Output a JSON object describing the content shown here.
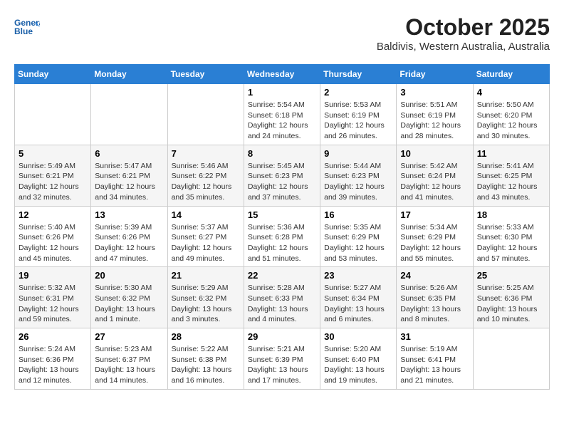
{
  "header": {
    "logo_text_1": "General",
    "logo_text_2": "Blue",
    "title": "October 2025",
    "subtitle": "Baldivis, Western Australia, Australia"
  },
  "days_of_week": [
    "Sunday",
    "Monday",
    "Tuesday",
    "Wednesday",
    "Thursday",
    "Friday",
    "Saturday"
  ],
  "weeks": [
    [
      {
        "day": "",
        "info": ""
      },
      {
        "day": "",
        "info": ""
      },
      {
        "day": "",
        "info": ""
      },
      {
        "day": "1",
        "info": "Sunrise: 5:54 AM\nSunset: 6:18 PM\nDaylight: 12 hours\nand 24 minutes."
      },
      {
        "day": "2",
        "info": "Sunrise: 5:53 AM\nSunset: 6:19 PM\nDaylight: 12 hours\nand 26 minutes."
      },
      {
        "day": "3",
        "info": "Sunrise: 5:51 AM\nSunset: 6:19 PM\nDaylight: 12 hours\nand 28 minutes."
      },
      {
        "day": "4",
        "info": "Sunrise: 5:50 AM\nSunset: 6:20 PM\nDaylight: 12 hours\nand 30 minutes."
      }
    ],
    [
      {
        "day": "5",
        "info": "Sunrise: 5:49 AM\nSunset: 6:21 PM\nDaylight: 12 hours\nand 32 minutes."
      },
      {
        "day": "6",
        "info": "Sunrise: 5:47 AM\nSunset: 6:21 PM\nDaylight: 12 hours\nand 34 minutes."
      },
      {
        "day": "7",
        "info": "Sunrise: 5:46 AM\nSunset: 6:22 PM\nDaylight: 12 hours\nand 35 minutes."
      },
      {
        "day": "8",
        "info": "Sunrise: 5:45 AM\nSunset: 6:23 PM\nDaylight: 12 hours\nand 37 minutes."
      },
      {
        "day": "9",
        "info": "Sunrise: 5:44 AM\nSunset: 6:23 PM\nDaylight: 12 hours\nand 39 minutes."
      },
      {
        "day": "10",
        "info": "Sunrise: 5:42 AM\nSunset: 6:24 PM\nDaylight: 12 hours\nand 41 minutes."
      },
      {
        "day": "11",
        "info": "Sunrise: 5:41 AM\nSunset: 6:25 PM\nDaylight: 12 hours\nand 43 minutes."
      }
    ],
    [
      {
        "day": "12",
        "info": "Sunrise: 5:40 AM\nSunset: 6:26 PM\nDaylight: 12 hours\nand 45 minutes."
      },
      {
        "day": "13",
        "info": "Sunrise: 5:39 AM\nSunset: 6:26 PM\nDaylight: 12 hours\nand 47 minutes."
      },
      {
        "day": "14",
        "info": "Sunrise: 5:37 AM\nSunset: 6:27 PM\nDaylight: 12 hours\nand 49 minutes."
      },
      {
        "day": "15",
        "info": "Sunrise: 5:36 AM\nSunset: 6:28 PM\nDaylight: 12 hours\nand 51 minutes."
      },
      {
        "day": "16",
        "info": "Sunrise: 5:35 AM\nSunset: 6:29 PM\nDaylight: 12 hours\nand 53 minutes."
      },
      {
        "day": "17",
        "info": "Sunrise: 5:34 AM\nSunset: 6:29 PM\nDaylight: 12 hours\nand 55 minutes."
      },
      {
        "day": "18",
        "info": "Sunrise: 5:33 AM\nSunset: 6:30 PM\nDaylight: 12 hours\nand 57 minutes."
      }
    ],
    [
      {
        "day": "19",
        "info": "Sunrise: 5:32 AM\nSunset: 6:31 PM\nDaylight: 12 hours\nand 59 minutes."
      },
      {
        "day": "20",
        "info": "Sunrise: 5:30 AM\nSunset: 6:32 PM\nDaylight: 13 hours\nand 1 minute."
      },
      {
        "day": "21",
        "info": "Sunrise: 5:29 AM\nSunset: 6:32 PM\nDaylight: 13 hours\nand 3 minutes."
      },
      {
        "day": "22",
        "info": "Sunrise: 5:28 AM\nSunset: 6:33 PM\nDaylight: 13 hours\nand 4 minutes."
      },
      {
        "day": "23",
        "info": "Sunrise: 5:27 AM\nSunset: 6:34 PM\nDaylight: 13 hours\nand 6 minutes."
      },
      {
        "day": "24",
        "info": "Sunrise: 5:26 AM\nSunset: 6:35 PM\nDaylight: 13 hours\nand 8 minutes."
      },
      {
        "day": "25",
        "info": "Sunrise: 5:25 AM\nSunset: 6:36 PM\nDaylight: 13 hours\nand 10 minutes."
      }
    ],
    [
      {
        "day": "26",
        "info": "Sunrise: 5:24 AM\nSunset: 6:36 PM\nDaylight: 13 hours\nand 12 minutes."
      },
      {
        "day": "27",
        "info": "Sunrise: 5:23 AM\nSunset: 6:37 PM\nDaylight: 13 hours\nand 14 minutes."
      },
      {
        "day": "28",
        "info": "Sunrise: 5:22 AM\nSunset: 6:38 PM\nDaylight: 13 hours\nand 16 minutes."
      },
      {
        "day": "29",
        "info": "Sunrise: 5:21 AM\nSunset: 6:39 PM\nDaylight: 13 hours\nand 17 minutes."
      },
      {
        "day": "30",
        "info": "Sunrise: 5:20 AM\nSunset: 6:40 PM\nDaylight: 13 hours\nand 19 minutes."
      },
      {
        "day": "31",
        "info": "Sunrise: 5:19 AM\nSunset: 6:41 PM\nDaylight: 13 hours\nand 21 minutes."
      },
      {
        "day": "",
        "info": ""
      }
    ]
  ]
}
